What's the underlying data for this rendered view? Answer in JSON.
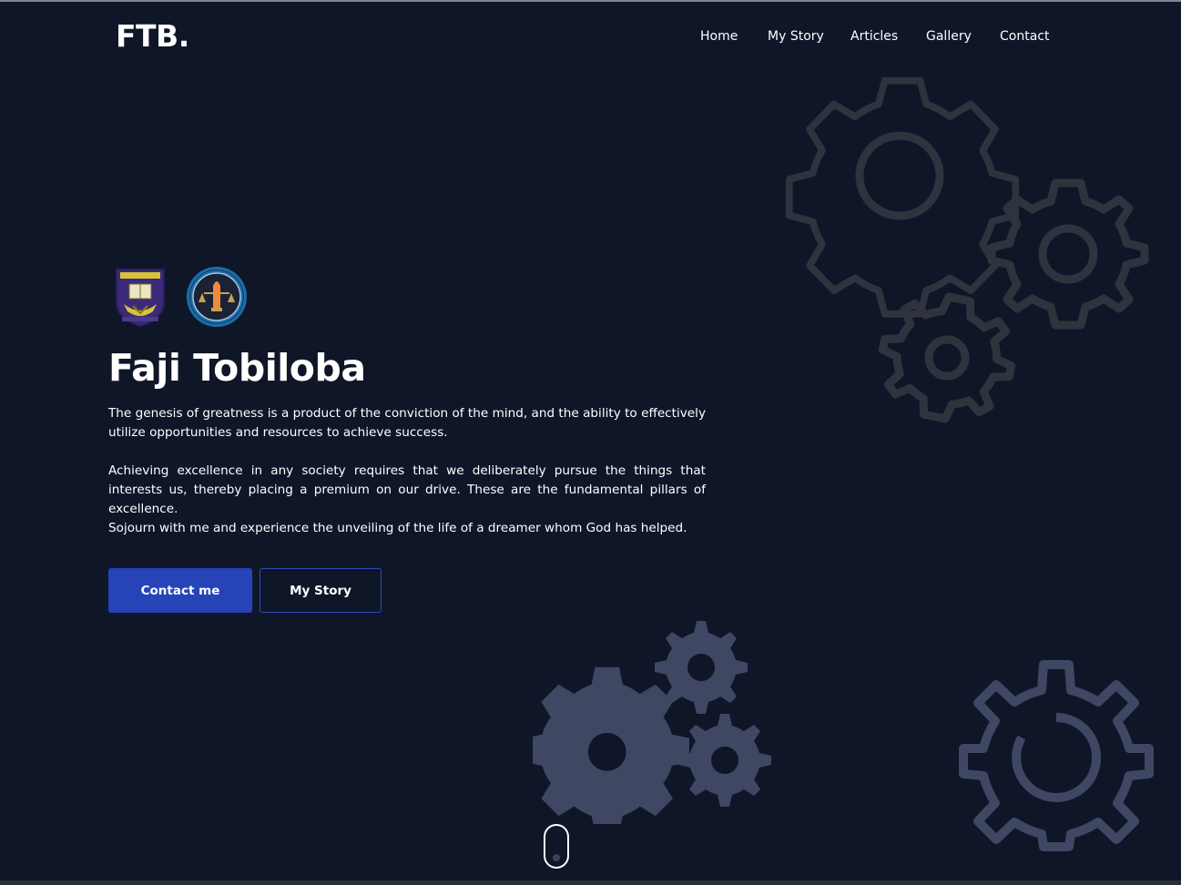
{
  "brand": {
    "logo_text": "FTB."
  },
  "nav": {
    "items": [
      {
        "label": "Home"
      },
      {
        "label": "My Story"
      },
      {
        "label": "Articles"
      },
      {
        "label": "Gallery"
      },
      {
        "label": "Contact"
      }
    ]
  },
  "hero": {
    "badges": [
      {
        "icon": "university-crest-icon"
      },
      {
        "icon": "law-society-seal-icon"
      }
    ],
    "title": "Faji Tobiloba",
    "paragraphs": [
      "The genesis of greatness is a product of the conviction of the mind, and the ability to effectively utilize opportunities and resources to achieve success.",
      "Achieving excellence in any society requires that we deliberately pursue the things that interests us, thereby placing a premium on our drive. These are the fundamental pillars of excellence.",
      "Sojourn with me and experience the unveiling of the life of a dreamer whom God has helped."
    ],
    "buttons": {
      "primary_label": "Contact me",
      "secondary_label": "My Story"
    }
  },
  "decorations": {
    "icons": [
      "gears-outline-icon",
      "gears-filled-icon",
      "gear-outline-icon"
    ]
  },
  "scroll": {
    "icon": "mouse-scroll-icon"
  },
  "colors": {
    "background": "#0f1628",
    "primary_button": "#2643b8",
    "gear_outline_dark": "#2f333d",
    "gear_fill": "#3f4763"
  }
}
